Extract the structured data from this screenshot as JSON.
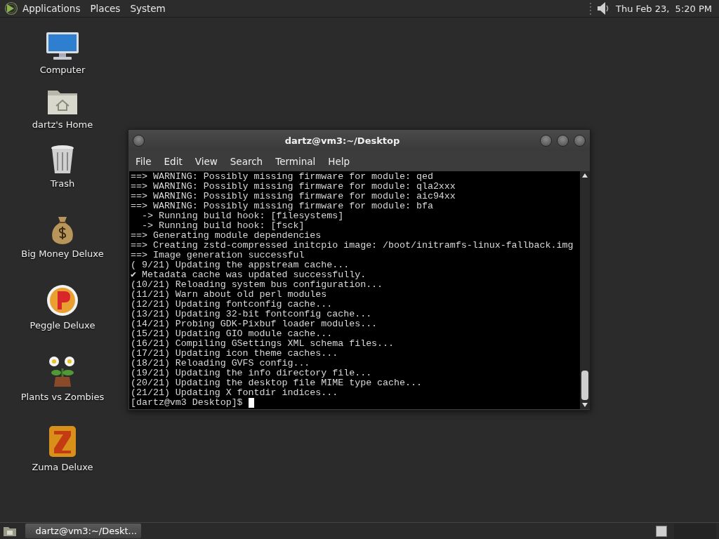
{
  "top_panel": {
    "menus": [
      "Applications",
      "Places",
      "System"
    ],
    "clock": "Thu Feb 23,  5:20 PM"
  },
  "desktop_icons": [
    {
      "kind": "computer",
      "label": "Computer"
    },
    {
      "kind": "home",
      "label": "dartz's Home"
    },
    {
      "kind": "trash",
      "label": "Trash"
    },
    {
      "kind": "money",
      "label": "Big Money Deluxe"
    },
    {
      "kind": "peggle",
      "label": "Peggle Deluxe"
    },
    {
      "kind": "plants",
      "label": "Plants vs Zombies"
    },
    {
      "kind": "zuma",
      "label": "Zuma Deluxe"
    }
  ],
  "window": {
    "title": "dartz@vm3:~/Desktop",
    "menu": [
      "File",
      "Edit",
      "View",
      "Search",
      "Terminal",
      "Help"
    ],
    "lines": [
      "==> WARNING: Possibly missing firmware for module: qed",
      "==> WARNING: Possibly missing firmware for module: qla2xxx",
      "==> WARNING: Possibly missing firmware for module: aic94xx",
      "==> WARNING: Possibly missing firmware for module: bfa",
      "  -> Running build hook: [filesystems]",
      "  -> Running build hook: [fsck]",
      "==> Generating module dependencies",
      "==> Creating zstd-compressed initcpio image: /boot/initramfs-linux-fallback.img",
      "==> Image generation successful",
      "( 9/21) Updating the appstream cache...",
      "✔ Metadata cache was updated successfully.",
      "(10/21) Reloading system bus configuration...",
      "(11/21) Warn about old perl modules",
      "(12/21) Updating fontconfig cache...",
      "(13/21) Updating 32-bit fontconfig cache...",
      "(14/21) Probing GDK-Pixbuf loader modules...",
      "(15/21) Updating GIO module cache...",
      "(16/21) Compiling GSettings XML schema files...",
      "(17/21) Updating icon theme caches...",
      "(18/21) Reloading GVFS config...",
      "(19/21) Updating the info directory file...",
      "(20/21) Updating the desktop file MIME type cache...",
      "(21/21) Updating X fontdir indices..."
    ],
    "prompt": "[dartz@vm3 Desktop]$"
  },
  "taskbar": {
    "tasks": [
      {
        "label": "dartz@vm3:~/Deskt...",
        "selected": true
      }
    ]
  }
}
